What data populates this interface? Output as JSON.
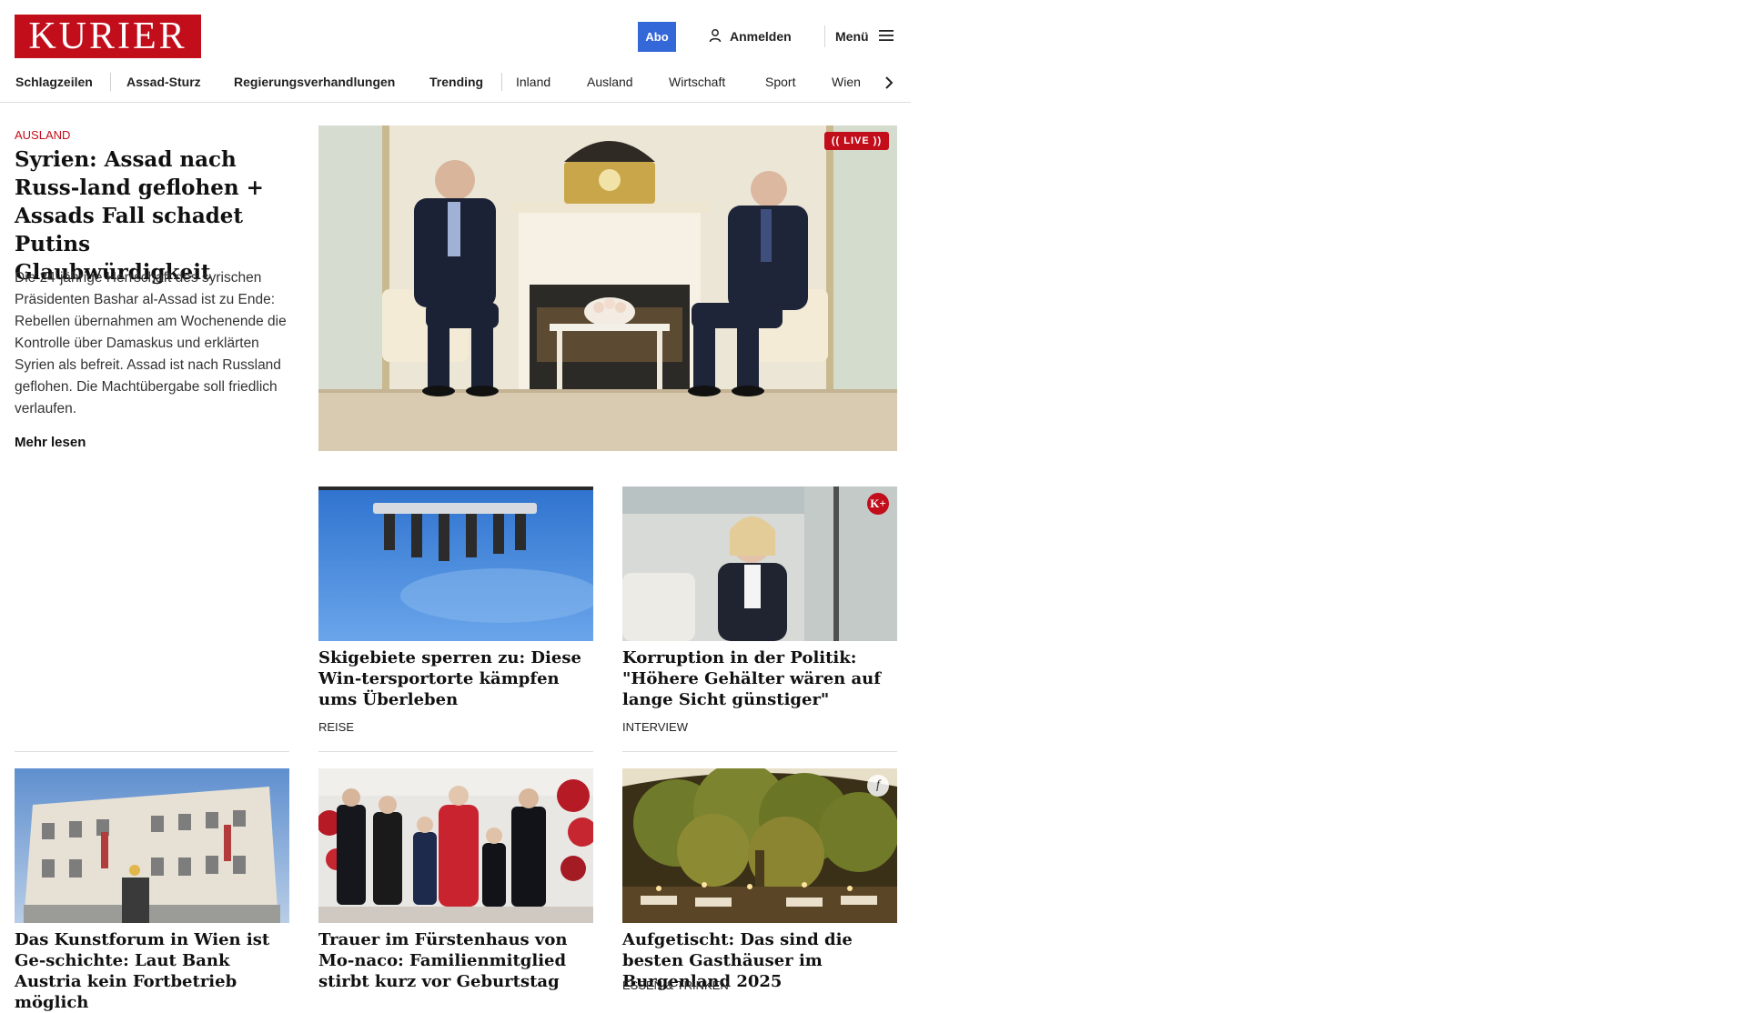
{
  "header": {
    "logo": "KURIER",
    "abo_label": "Abo",
    "login_label": "Anmelden",
    "menu_label": "Menü"
  },
  "nav": {
    "items": [
      "Schlagzeilen",
      "Assad-Sturz",
      "Regierungsverhandlungen",
      "Trending",
      "Inland",
      "Ausland",
      "Wirtschaft",
      "Sport",
      "Wien"
    ]
  },
  "lead": {
    "kicker": "AUSLAND",
    "title": "Syrien: Assad nach Russ-land geflohen + Assads Fall schadet Putins Glaubwürdigkeit",
    "description": "Die 24-jährige Herrschaft des syrischen Präsidenten Bashar al-Assad ist zu Ende: Rebellen übernahmen am Wochenende die Kontrolle über Damaskus und erklärten Syrien als befreit. Assad ist nach Russland geflohen. Die Machtübergabe soll friedlich verlaufen.",
    "more_label": "Mehr lesen",
    "live_label": "(( LIVE ))"
  },
  "cards": [
    {
      "title": "Skigebiete sperren zu: Diese Win-tersportorte kämpfen ums Überleben",
      "category": "REISE"
    },
    {
      "title": "Korruption in der Politik: \"Höhere Gehälter wären auf lange Sicht günstiger\"",
      "category": "INTERVIEW",
      "badge": "K+"
    },
    {
      "title": "Das Kunstforum in Wien ist Ge-schichte: Laut Bank Austria kein Fortbetrieb möglich",
      "category": ""
    },
    {
      "title": "Trauer im Fürstenhaus von Mo-naco: Familienmitglied stirbt kurz vor Geburtstag",
      "category": ""
    },
    {
      "title": "Aufgetischt: Das sind die besten Gasthäuser im Burgenland 2025",
      "category": "ESSEN & TRINKEN",
      "badge": "f"
    }
  ],
  "icons": {
    "login": "user-icon",
    "menu": "hamburger-icon",
    "nav_next": "chevron-right-icon"
  },
  "colors": {
    "brand": "#c20d1b",
    "abo": "#3468d8"
  }
}
